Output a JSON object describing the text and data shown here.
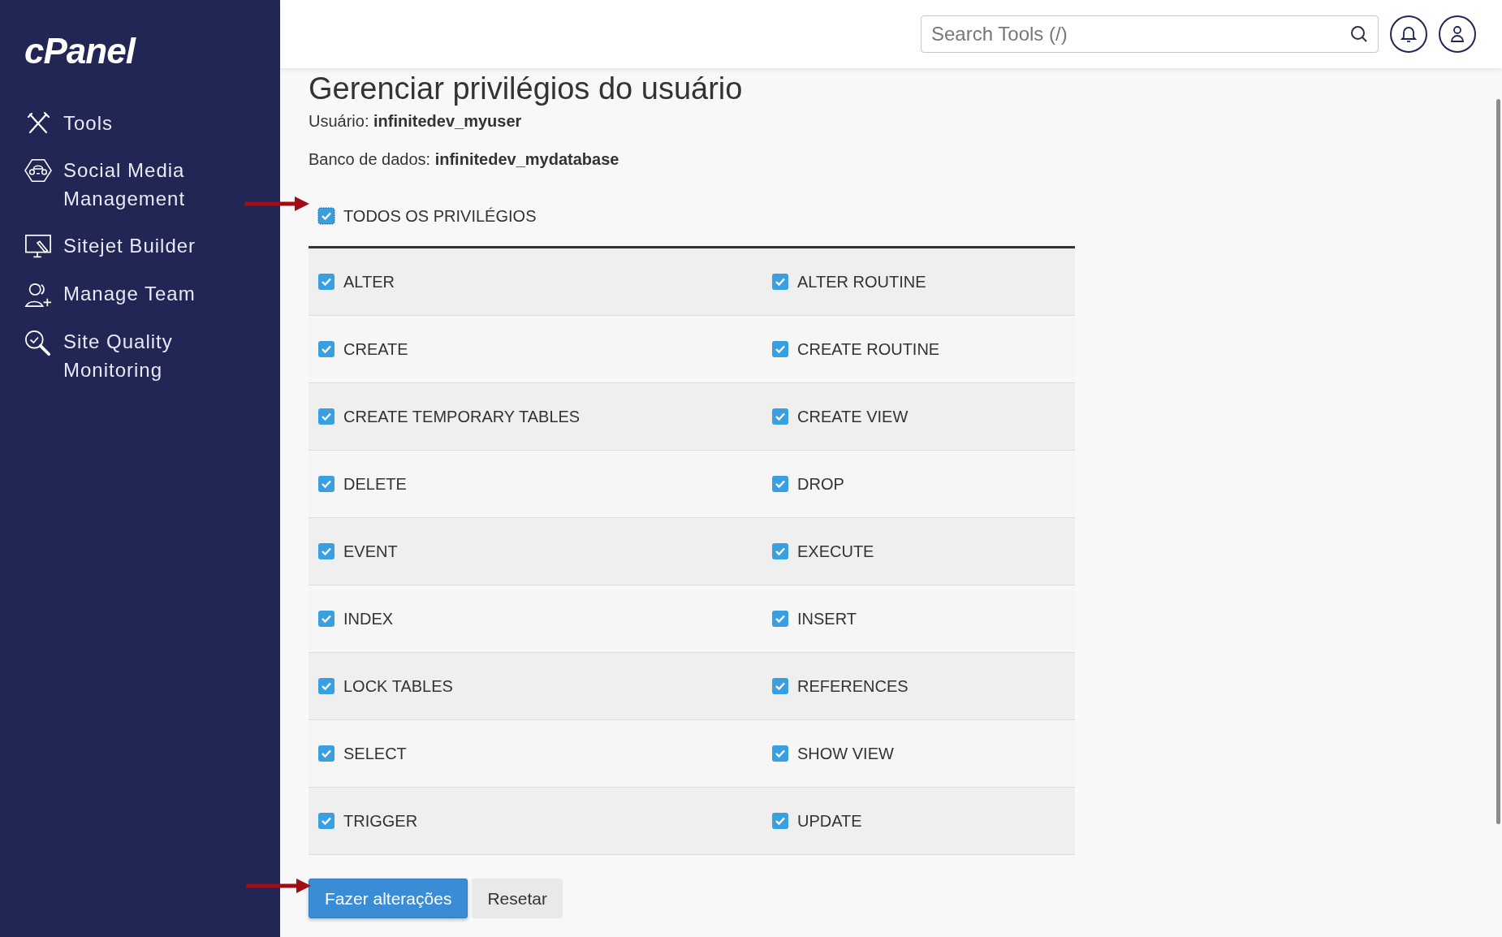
{
  "sidebar": {
    "logo": "cPanel",
    "items": [
      {
        "label": "Tools"
      },
      {
        "label": "Social Media Management"
      },
      {
        "label": "Sitejet Builder"
      },
      {
        "label": "Manage Team"
      },
      {
        "label": "Site Quality Monitoring"
      }
    ]
  },
  "header": {
    "search": {
      "placeholder": "Search Tools (/)"
    }
  },
  "page": {
    "title": "Gerenciar privilégios do usuário",
    "user": {
      "label": "Usuário:",
      "value": "infinitedev_myuser"
    },
    "database": {
      "label": "Banco de dados:",
      "value": "infinitedev_mydatabase"
    },
    "all_privileges": {
      "label": "TODOS OS PRIVILÉGIOS",
      "checked": true
    },
    "privileges": [
      {
        "label": "ALTER",
        "checked": true
      },
      {
        "label": "ALTER ROUTINE",
        "checked": true
      },
      {
        "label": "CREATE",
        "checked": true
      },
      {
        "label": "CREATE ROUTINE",
        "checked": true
      },
      {
        "label": "CREATE TEMPORARY TABLES",
        "checked": true
      },
      {
        "label": "CREATE VIEW",
        "checked": true
      },
      {
        "label": "DELETE",
        "checked": true
      },
      {
        "label": "DROP",
        "checked": true
      },
      {
        "label": "EVENT",
        "checked": true
      },
      {
        "label": "EXECUTE",
        "checked": true
      },
      {
        "label": "INDEX",
        "checked": true
      },
      {
        "label": "INSERT",
        "checked": true
      },
      {
        "label": "LOCK TABLES",
        "checked": true
      },
      {
        "label": "REFERENCES",
        "checked": true
      },
      {
        "label": "SELECT",
        "checked": true
      },
      {
        "label": "SHOW VIEW",
        "checked": true
      },
      {
        "label": "TRIGGER",
        "checked": true
      },
      {
        "label": "UPDATE",
        "checked": true
      }
    ],
    "buttons": [
      {
        "label": "Fazer alterações",
        "kind": "primary"
      },
      {
        "label": "Resetar",
        "kind": "secondary"
      }
    ]
  }
}
